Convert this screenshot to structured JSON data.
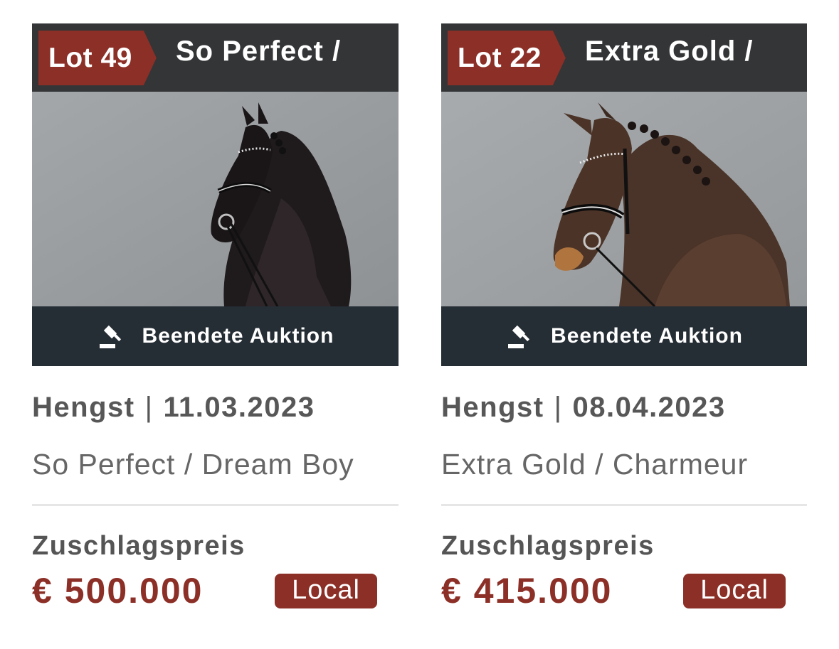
{
  "cards": [
    {
      "lot_label": "Lot 49",
      "title": "So Perfect /",
      "image_icon": "horse-photo",
      "status_icon": "gavel-icon",
      "status": "Beendete Auktion",
      "sex": "Hengst",
      "separator": "|",
      "date": "11.03.2023",
      "pedigree": "So Perfect / Dream Boy",
      "price_label": "Zuschlagspreis",
      "price": "€ 500.000",
      "badge": "Local"
    },
    {
      "lot_label": "Lot 22",
      "title": "Extra Gold /",
      "image_icon": "horse-photo",
      "status_icon": "gavel-icon",
      "status": "Beendete Auktion",
      "sex": "Hengst",
      "separator": "|",
      "date": "08.04.2023",
      "pedigree": "Extra Gold / Charmeur",
      "price_label": "Zuschlagspreis",
      "price": "€ 415.000",
      "badge": "Local"
    }
  ],
  "colors": {
    "accent": "#8c2f27",
    "header_bg": "#333537",
    "status_bg": "#252d35",
    "photo_bg": "#9a9ea0"
  }
}
